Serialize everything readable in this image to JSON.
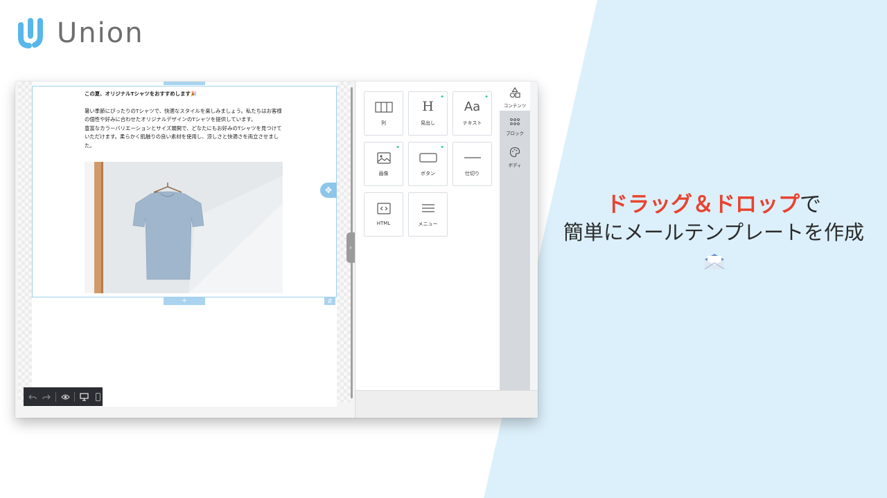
{
  "brand": {
    "name": "Union",
    "accent": "#58b7ea",
    "bg_accent": "#dcf0fb"
  },
  "content": {
    "title": "この夏、オリジナルTシャツをおすすめします🎉",
    "para1": "暑い季節にぴったりのTシャツで、快適なスタイルを楽しみましょう。私たちはお客様の個性や好みに合わせたオリジナルデザインのTシャツを提供しています。",
    "para2": "豊富なカラーバリエーションとサイズ展開で、どなたにもお好みのTシャツを見つけていただけます。柔らかく肌触りの良い素材を使用し、涼しさと快適さを両立させました。",
    "image_alt": "t-shirt on hanger"
  },
  "panel": {
    "tiles": [
      {
        "label": "列",
        "icon": "columns-icon",
        "new": false
      },
      {
        "label": "見出し",
        "icon": "heading-icon",
        "new": true
      },
      {
        "label": "テキスト",
        "icon": "text-icon",
        "new": true
      },
      {
        "label": "画像",
        "icon": "image-icon",
        "new": true
      },
      {
        "label": "ボタン",
        "icon": "button-icon",
        "new": true
      },
      {
        "label": "仕切り",
        "icon": "divider-icon",
        "new": false
      },
      {
        "label": "HTML",
        "icon": "html-icon",
        "new": false
      },
      {
        "label": "メニュー",
        "icon": "menu-icon",
        "new": false
      }
    ],
    "heading_glyph": "H",
    "text_glyph": "Aa",
    "side_tabs": [
      {
        "label": "コンテンツ",
        "icon": "shapes-icon",
        "active": true
      },
      {
        "label": "ブロック",
        "icon": "grid-dots-icon",
        "active": false
      },
      {
        "label": "ボディ",
        "icon": "palette-icon",
        "active": false
      }
    ]
  },
  "headline": {
    "line1_red": "ドラッグ＆ドロップ",
    "line1_rest": "で",
    "line2": "簡単にメールテンプレートを作成"
  }
}
